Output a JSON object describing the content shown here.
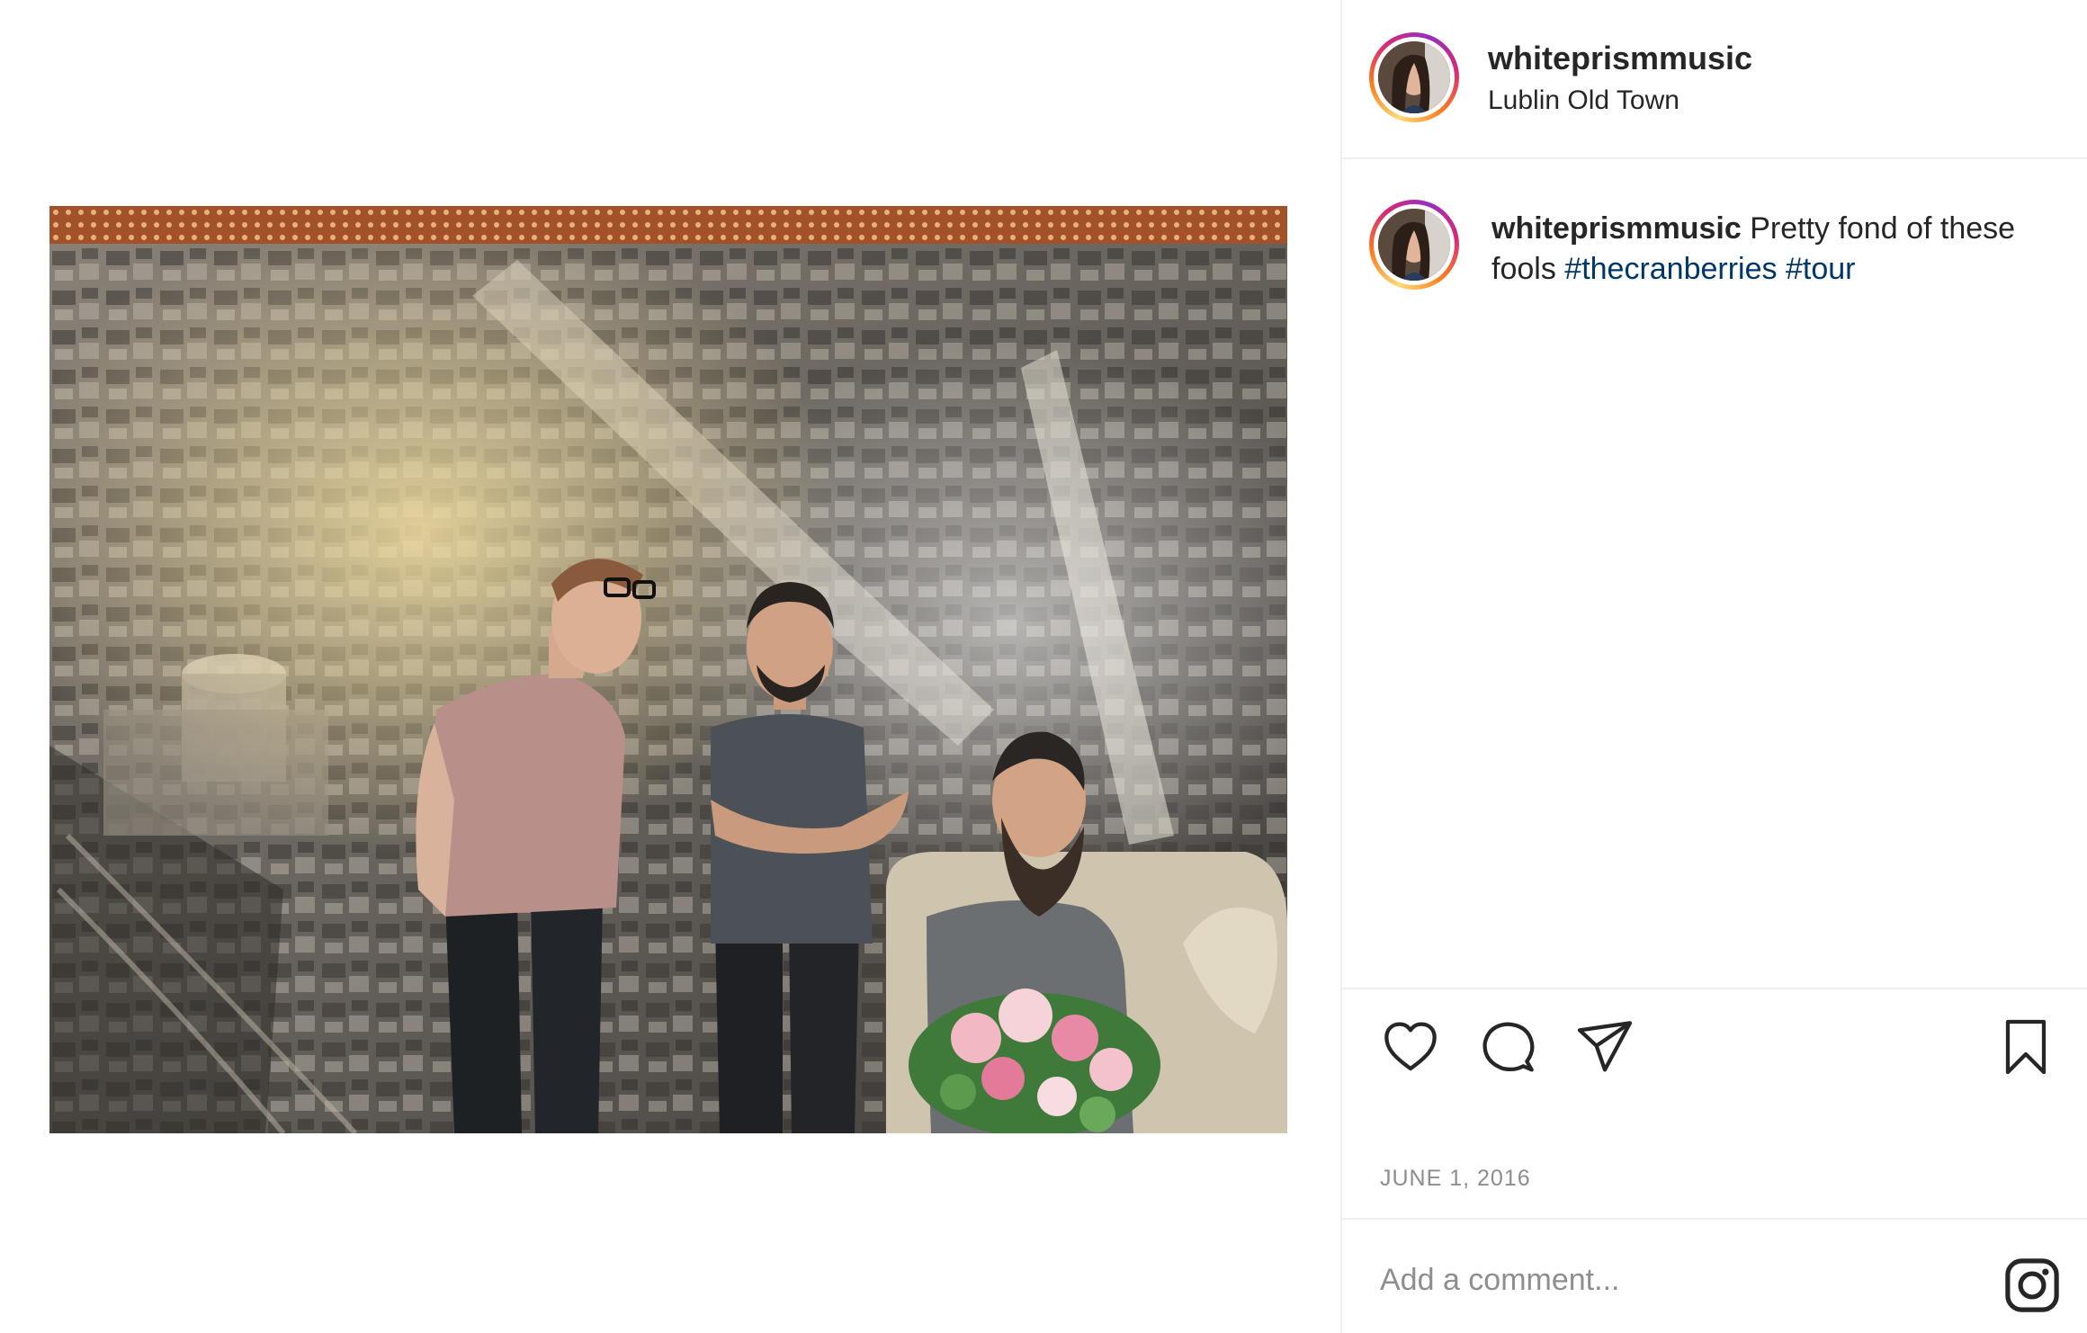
{
  "post": {
    "username": "whiteprismmusic",
    "location": "Lublin Old Town",
    "caption": {
      "username": "whiteprismmusic",
      "text": "Pretty fond of these fools",
      "hashtags": [
        "#thecranberries",
        "#tour"
      ]
    },
    "date": "JUNE 1, 2016"
  },
  "comment": {
    "placeholder": "Add a comment..."
  },
  "icons": {
    "like": "heart-icon",
    "comment": "comment-icon",
    "share": "paper-plane-icon",
    "save": "bookmark-icon",
    "brand": "instagram-logo-icon"
  },
  "colors": {
    "hashtag": "#00376b",
    "muted": "#8e8e8e",
    "text": "#262626",
    "divider": "#efefef"
  }
}
